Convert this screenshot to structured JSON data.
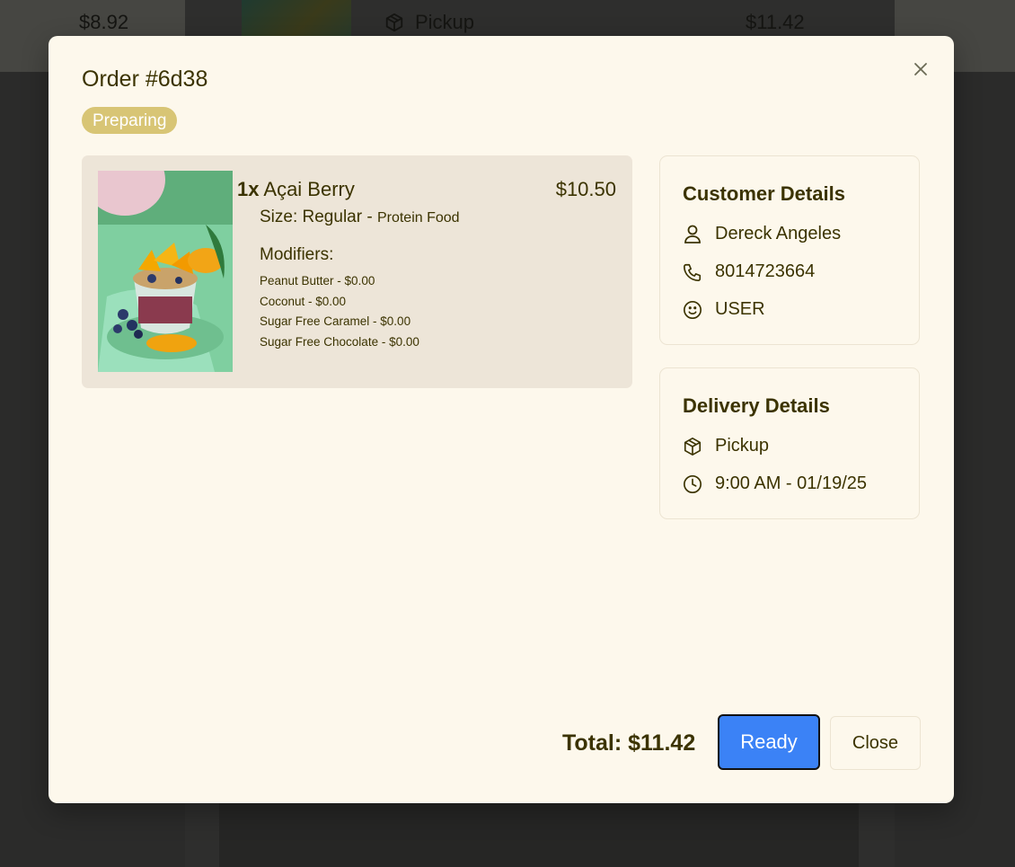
{
  "background": {
    "left_price": "$8.92",
    "pickup_label": "Pickup",
    "right_price": "$11.42"
  },
  "modal": {
    "title": "Order #6d38",
    "status": "Preparing",
    "close_icon": "close-icon"
  },
  "item": {
    "quantity": "1x",
    "name": "Açai Berry",
    "price": "$10.50",
    "size": "Size: Regular -",
    "category": "Protein Food",
    "modifiers_title": "Modifiers:",
    "modifiers": [
      "Peanut Butter - $0.00",
      "Coconut - $0.00",
      "Sugar Free Caramel - $0.00",
      "Sugar Free Chocolate - $0.00"
    ]
  },
  "customer": {
    "title": "Customer Details",
    "name": "Dereck Angeles",
    "phone": "8014723664",
    "role": "USER"
  },
  "delivery": {
    "title": "Delivery Details",
    "method": "Pickup",
    "time": "9:00 AM - 01/19/25"
  },
  "footer": {
    "total": "Total: $11.42",
    "ready_label": "Ready",
    "close_label": "Close"
  },
  "colors": {
    "badge": "#d8c575",
    "primary_button": "#3b82f6",
    "text": "#3b3300",
    "modal_bg": "#fdf8ec"
  }
}
